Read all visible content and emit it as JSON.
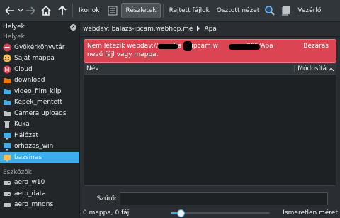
{
  "toolbar": {
    "back_icon": "back-arrow-icon",
    "forward_icon": "forward-arrow-icon",
    "home_icon": "home-icon",
    "up_icon": "up-arrow-icon",
    "view_icons_label": "Ikonok",
    "view_details_label": "Részletek",
    "hidden_files_label": "Rejtett fájlok",
    "split_view_label": "Osztott nézet",
    "search_icon": "search-icon",
    "control_label": "Vezérlő"
  },
  "sidebar": {
    "title": "Helyek",
    "places_header": "Helyek",
    "places": [
      {
        "label": "Gyökérkönyvtár",
        "icon": "root-folder-icon",
        "color": "#da4453"
      },
      {
        "label": "Saját mappa",
        "icon": "home-smiley-icon",
        "color": "#fdbc4b"
      },
      {
        "label": "Cloud",
        "icon": "cloud-icon",
        "color": "#da4453"
      },
      {
        "label": "download",
        "icon": "download-folder-icon",
        "color": "#f67400"
      },
      {
        "label": "video_film_klip",
        "icon": "video-folder-icon",
        "color": "#3daee9"
      },
      {
        "label": "Képek_mentett",
        "icon": "pictures-folder-icon",
        "color": "#3daee9"
      },
      {
        "label": "Camera uploads",
        "icon": "camera-folder-icon",
        "color": "#bdc3c7"
      },
      {
        "label": "Kuka",
        "icon": "trash-icon",
        "color": "#bdc3c7"
      },
      {
        "label": "Hálózat",
        "icon": "network-icon",
        "color": "#3daee9"
      },
      {
        "label": "orhazas_win",
        "icon": "network-drive-icon",
        "color": "#3daee9"
      },
      {
        "label": "bazsinas",
        "icon": "network-drive-icon",
        "color": "#fdbc4b"
      }
    ],
    "devices_header": "Eszközök",
    "devices": [
      {
        "label": "aero_w10",
        "icon": "drive-icon"
      },
      {
        "label": "aero_data",
        "icon": "drive-icon"
      },
      {
        "label": "aero_mndns",
        "icon": "drive-icon"
      }
    ]
  },
  "main": {
    "breadcrumb_path": "webdav: balazs-ipcam.webhop.me",
    "breadcrumb_current": "Apa",
    "error": {
      "line1_start": "Nem létezik webdav://",
      "line1_mid": "ba",
      "line1_mid2": "ipcam.w",
      "line1_end": "005/Apa",
      "line2": "nevű fájl vagy mappa.",
      "close_label": "Bezárás"
    },
    "columns": {
      "name": "Név",
      "modified": "Módosítá"
    },
    "filter_label": "Szűrő:",
    "status_text": "0 mappa, 0 fájl",
    "zoom_fraction": 0.1,
    "free_space_text": "Ismeretlen méret"
  }
}
